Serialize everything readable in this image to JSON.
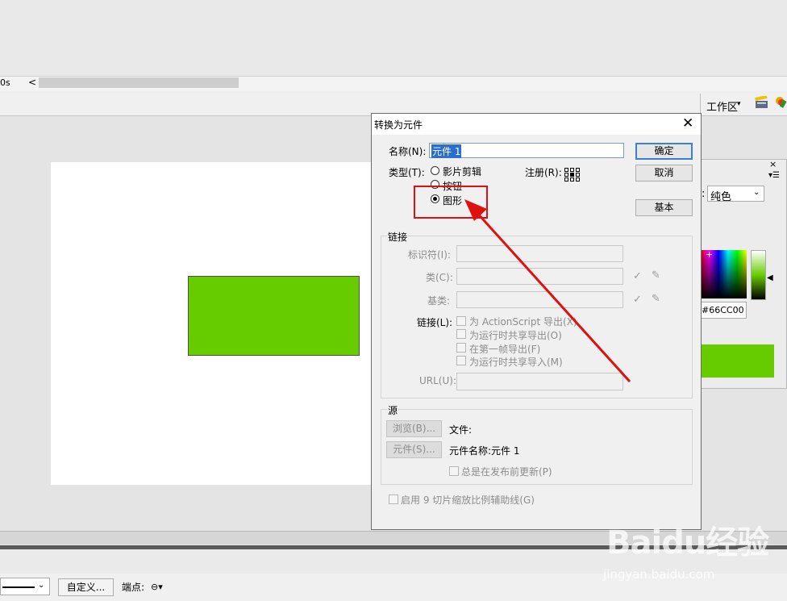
{
  "timeline": {
    "time": "0s",
    "scroll_left": "<"
  },
  "toolbar": {
    "workspace": "工作区",
    "workspace_caret": "▾"
  },
  "color_panel": {
    "close": "×",
    "menu": "▾☰",
    "fill_type_label": ":",
    "fill_type": "纯色",
    "fill_caret": "⌄",
    "hex": "#66CC00",
    "brightness_arrow": "◀",
    "crosshair": "+",
    "color": "#66cc00"
  },
  "dialog": {
    "title": "转换为元件",
    "close": "✕",
    "name_label": "名称(N):",
    "name_value": "元件 1",
    "type_label": "类型(T):",
    "types": [
      "影片剪辑",
      "按钮",
      "图形"
    ],
    "selected_type": "图形",
    "registration_label": "注册(R):",
    "ok": "确定",
    "cancel": "取消",
    "basic": "基本",
    "linkage": {
      "title": "链接",
      "identifier_label": "标识符(I):",
      "class_label": "类(C):",
      "baseclass_label": "基类:",
      "linkage_label": "链接(L):",
      "options": [
        "为 ActionScript 导出(X)",
        "为运行时共享导出(O)",
        "在第一帧导出(F)",
        "为运行时共享导入(M)"
      ],
      "url_label": "URL(U):",
      "check_glyph": "✓",
      "edit_glyph": "✎"
    },
    "source": {
      "title": "源",
      "browse": "浏览(B)...",
      "file_label": "文件:",
      "symbol": "元件(S)...",
      "symbol_name": "元件名称:元件 1",
      "always_update": "总是在发布前更新(P)"
    },
    "nine_slice": "启用 9 切片缩放比例辅助线(G)"
  },
  "properties": {
    "stroke_caret": "⌄",
    "custom_button": "自定义...",
    "cap_label": "端点:",
    "cap_icon": "⊖▾"
  },
  "annotation_color": "#e01010",
  "watermark": {
    "logo": "Baidu经验",
    "url": "jingyan.baidu.com"
  }
}
